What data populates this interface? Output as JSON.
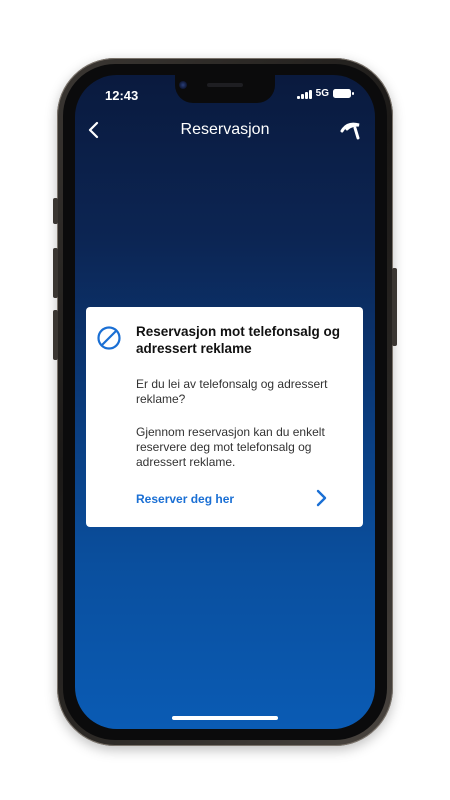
{
  "status_bar": {
    "time": "12:43",
    "network": "5G",
    "icons": [
      "signal-bars-icon",
      "battery-icon"
    ]
  },
  "nav": {
    "title": "Reservasjon",
    "back_icon": "chevron-left-icon",
    "logo_icon": "telenor-logo-icon"
  },
  "card": {
    "icon": "prohibited-icon",
    "title": "Reservasjon mot telefonsalg og adressert reklame",
    "paragraph1": "Er du lei av telefonsalg og adressert reklame?",
    "paragraph2": "Gjennom reservasjon kan du enkelt reservere deg mot telefonsalg og adressert reklame.",
    "link_label": "Reserver deg her",
    "link_icon": "chevron-right-icon"
  },
  "colors": {
    "accent": "#1a6fd4",
    "background_top": "#0a1a3e",
    "background_bottom": "#0a5bb4"
  }
}
